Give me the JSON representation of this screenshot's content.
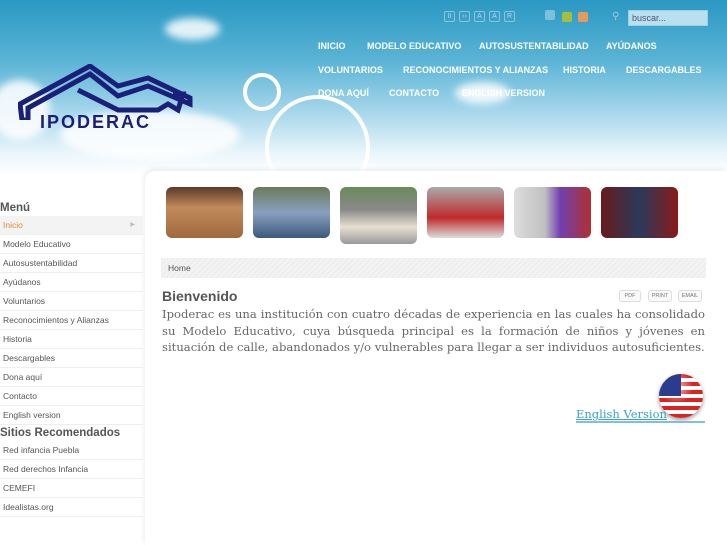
{
  "header": {
    "logo_text": "IPODERAC",
    "search_placeholder": "buscar...",
    "tool_icons": [
      "II",
      "‹›",
      "A",
      "A",
      "R"
    ],
    "swatches": {
      "green": "#a6be3c",
      "orange": "#e89a5a"
    },
    "nav": [
      "INICIO",
      "MODELO EDUCATIVO",
      "AUTOSUSTENTABILIDAD",
      "AYÚDANOS",
      "VOLUNTARIOS",
      "RECONOCIMIENTOS Y ALIANZAS",
      "HISTORIA",
      "DESCARGABLES",
      "DONA AQUÍ",
      "CONTACTO",
      "ENGLISH VERSION"
    ]
  },
  "sidebar": {
    "menu_title": "Menú",
    "menu": [
      "Inicio",
      "Modelo Educativo",
      "Autosustentabilidad",
      "Ayúdanos",
      "Voluntarios",
      "Reconocimientos y Alianzas",
      "Historia",
      "Descargables",
      "Dona aquí",
      "Contacto",
      "English version"
    ],
    "sites_title": "Sitios Recomendados",
    "sites": [
      "Red infancia Puebla",
      "Red derechos Infancia",
      "CEMEFI",
      "Idealistas.org"
    ]
  },
  "content": {
    "breadcrumb": "Home",
    "title": "Bienvenido",
    "buttons": [
      "PDF",
      "PRINT",
      "EMAIL"
    ],
    "body": "Ipoderac es una institución con cuatro décadas de experiencia en las cuales ha consolidado su Modelo Educativo, cuya búsqueda principal es la formación de niños y jóvenes en situación de calle, abandonados y/o vulnerables para llegar a ser individuos autosuficientes.",
    "english_link": "English Version"
  },
  "colors": {
    "accent": "#e8893a",
    "logo": "#1a1f7a",
    "link": "#3aa0c8"
  }
}
